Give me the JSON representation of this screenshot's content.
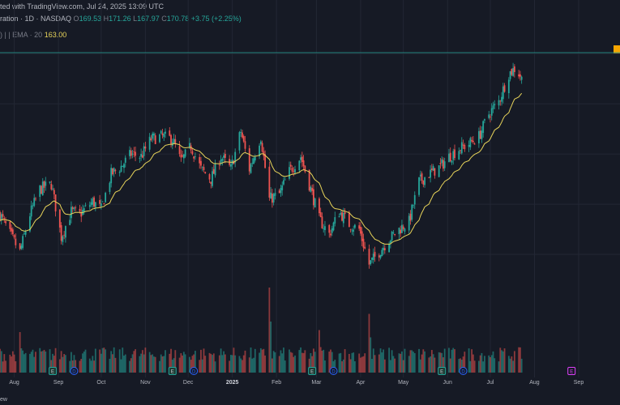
{
  "header": {
    "published": "ted with TradingView.com, Jul 24, 2025 13:09 UTC",
    "symbol": "ration · 1D · NASDAQ",
    "o_label": "O",
    "o_value": "169.53",
    "h_label": "H",
    "h_value": "171.26",
    "l_label": "L",
    "l_value": "167.97",
    "c_label": "C",
    "c_value": "170.78",
    "change": "+3.75 (+2.25%)",
    "ema_prefix": ") | | EMA · 20",
    "ema_value": "163.00"
  },
  "colors": {
    "background": "#161a25",
    "up": "#26a69a",
    "down": "#ef5350",
    "ema": "#e8d45a",
    "grid": "#232734",
    "price_line": "#26a69a",
    "marker_e": "#26a69a",
    "marker_d": "#2962ff",
    "marker_future": "#e040fb"
  },
  "xaxis": {
    "labels": [
      "Aug",
      "Sep",
      "Oct",
      "Nov",
      "Dec",
      "2025",
      "Feb",
      "Mar",
      "Apr",
      "May",
      "Jun",
      "Jul",
      "Aug",
      "Sep"
    ],
    "bold": [
      "2025"
    ]
  },
  "markers": [
    {
      "label": "E",
      "type": "earnings"
    },
    {
      "label": "D",
      "type": "dividend"
    },
    {
      "label": "E",
      "type": "earnings"
    },
    {
      "label": "D",
      "type": "dividend"
    },
    {
      "label": "E",
      "type": "earnings"
    },
    {
      "label": "D",
      "type": "dividend"
    },
    {
      "label": "E",
      "type": "earnings"
    },
    {
      "label": "D",
      "type": "dividend"
    },
    {
      "label": "E",
      "type": "future-earnings"
    }
  ],
  "footer": {
    "left_text": "ew"
  },
  "chart_data": {
    "type": "candlestick",
    "interval": "1D",
    "indicator": "EMA 20",
    "price_anchors": [
      [
        "2024-07-22",
        116
      ],
      [
        "2024-07-29",
        108
      ],
      [
        "2024-08-05",
        101
      ],
      [
        "2024-08-12",
        116
      ],
      [
        "2024-08-19",
        126
      ],
      [
        "2024-08-27",
        128
      ],
      [
        "2024-09-03",
        107
      ],
      [
        "2024-09-10",
        117
      ],
      [
        "2024-09-16",
        116
      ],
      [
        "2024-09-25",
        121
      ],
      [
        "2024-10-01",
        118
      ],
      [
        "2024-10-08",
        132
      ],
      [
        "2024-10-15",
        135
      ],
      [
        "2024-10-22",
        140
      ],
      [
        "2024-10-29",
        139
      ],
      [
        "2024-11-05",
        146
      ],
      [
        "2024-11-12",
        147
      ],
      [
        "2024-11-20",
        146
      ],
      [
        "2024-11-26",
        137
      ],
      [
        "2024-12-03",
        143
      ],
      [
        "2024-12-10",
        134
      ],
      [
        "2024-12-17",
        130
      ],
      [
        "2024-12-24",
        139
      ],
      [
        "2024-12-31",
        134
      ],
      [
        "2025-01-07",
        149
      ],
      [
        "2025-01-13",
        134
      ],
      [
        "2025-01-21",
        147
      ],
      [
        "2025-01-27",
        122
      ],
      [
        "2025-02-03",
        124
      ],
      [
        "2025-02-10",
        133
      ],
      [
        "2025-02-18",
        139
      ],
      [
        "2025-02-25",
        126
      ],
      [
        "2025-03-03",
        114
      ],
      [
        "2025-03-10",
        108
      ],
      [
        "2025-03-17",
        117
      ],
      [
        "2025-03-24",
        112
      ],
      [
        "2025-03-31",
        110
      ],
      [
        "2025-04-07",
        96
      ],
      [
        "2025-04-14",
        101
      ],
      [
        "2025-04-21",
        106
      ],
      [
        "2025-04-28",
        110
      ],
      [
        "2025-05-05",
        113
      ],
      [
        "2025-05-12",
        129
      ],
      [
        "2025-05-19",
        132
      ],
      [
        "2025-05-27",
        135
      ],
      [
        "2025-06-02",
        139
      ],
      [
        "2025-06-09",
        142
      ],
      [
        "2025-06-16",
        144
      ],
      [
        "2025-06-23",
        147
      ],
      [
        "2025-06-30",
        156
      ],
      [
        "2025-07-07",
        161
      ],
      [
        "2025-07-14",
        172
      ],
      [
        "2025-07-18",
        174
      ],
      [
        "2025-07-23",
        170.78
      ]
    ],
    "last": {
      "open": 169.53,
      "high": 171.26,
      "low": 167.97,
      "close": 170.78
    },
    "ema_last": 163.0,
    "volume_spikes": [
      [
        "2025-01-27",
        4.2
      ],
      [
        "2025-04-07",
        2.9
      ],
      [
        "2025-03-03",
        2.1
      ],
      [
        "2024-08-05",
        2.0
      ]
    ],
    "x_range": [
      "2024-07-22",
      "2025-09-30"
    ],
    "y_range": [
      90,
      182
    ],
    "grid": true
  }
}
